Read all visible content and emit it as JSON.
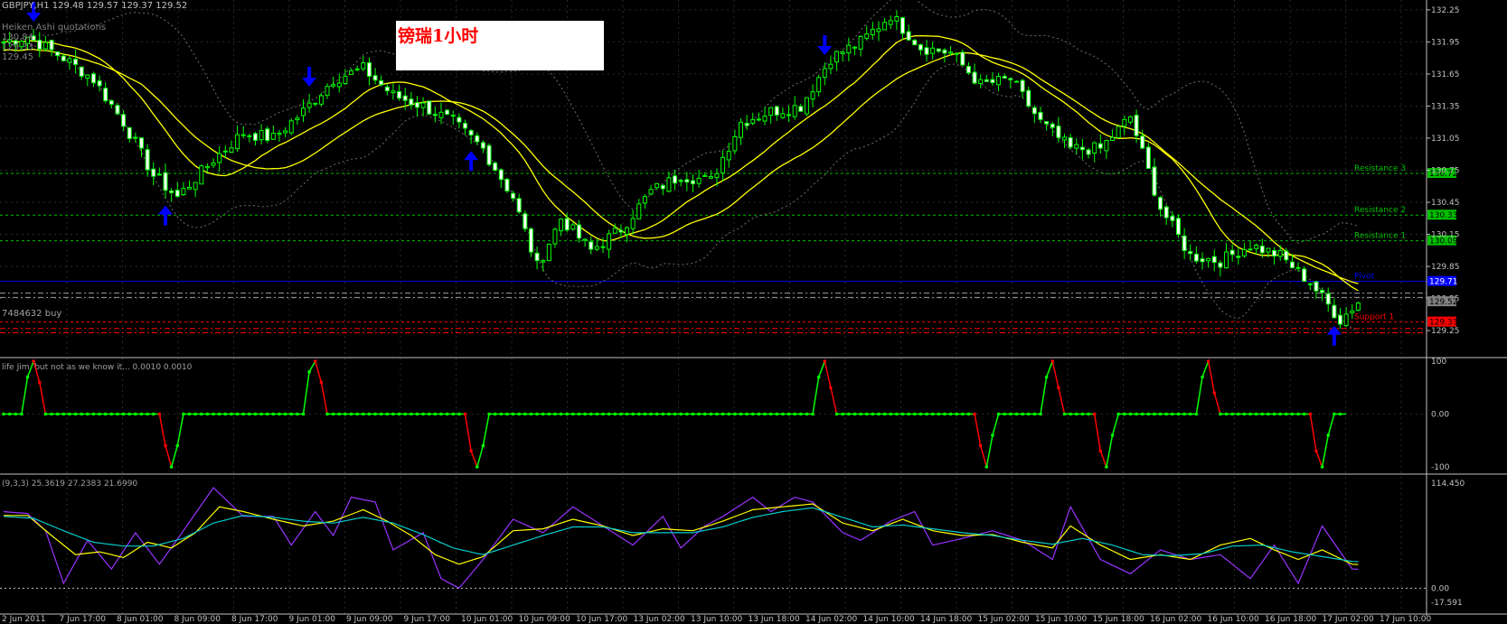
{
  "header": {
    "symbol_line": "GBPJPY,H1  129.48 129.57 129.37 129.52",
    "quotes_label": "Heiken Ashi quotations",
    "quote_lines": [
      "130.84",
      "129.33",
      "129.45"
    ],
    "order_label": "7484632 buy"
  },
  "title_box": {
    "text": "镑瑞1小时"
  },
  "colors": {
    "background": "#000000",
    "bull_candle": "#00ff00",
    "bear_candle": "#ffffff",
    "ma": "#ffff00",
    "resistance": "#00c000",
    "support": "#ff0000",
    "pivot": "#0000ff",
    "arrow": "#0000ff",
    "osc_up": "#00ff00",
    "osc_down": "#ff0000",
    "stoch_k": "#9933ff",
    "stoch_d": "#ffff00",
    "stoch_slow": "#00cccc"
  },
  "chart_data": [
    {
      "type": "candlestick",
      "title": "GBPJPY,H1",
      "ylim": [
        129.2,
        132.3
      ],
      "price_ticks": [
        "132.25",
        "131.95",
        "131.65",
        "131.35",
        "131.05",
        "130.75",
        "130.45",
        "130.15",
        "129.85",
        "129.55",
        "129.25"
      ],
      "levels": [
        {
          "name": "Resistance 3",
          "value": 130.72,
          "label": "130.72",
          "color": "#00c000"
        },
        {
          "name": "Resistance 2",
          "value": 130.33,
          "label": "130.33",
          "color": "#00c000"
        },
        {
          "name": "Resistance 1",
          "value": 130.09,
          "label": "130.09",
          "color": "#00c000"
        },
        {
          "name": "Pivot",
          "value": 129.71,
          "label": "129.71",
          "color": "#0000ff"
        },
        {
          "name": "Support 1",
          "value": 129.33,
          "label": "129.33",
          "color": "#ff0000"
        }
      ],
      "buy_line": 129.6,
      "current_price": {
        "value": 129.52,
        "label": "129.52"
      },
      "x_labels": [
        "2 Jun 2011",
        "7 Jun 17:00",
        "8 Jun 01:00",
        "8 Jun 09:00",
        "8 Jun 17:00",
        "9 Jun 01:00",
        "9 Jun 09:00",
        "9 Jun 17:00",
        "10 Jun 01:00",
        "10 Jun 09:00",
        "10 Jun 17:00",
        "13 Jun 02:00",
        "13 Jun 10:00",
        "13 Jun 18:00",
        "14 Jun 02:00",
        "14 Jun 10:00",
        "14 Jun 18:00",
        "15 Jun 02:00",
        "15 Jun 10:00",
        "15 Jun 18:00",
        "16 Jun 02:00",
        "16 Jun 10:00",
        "16 Jun 18:00",
        "17 Jun 02:00",
        "17 Jun 10:00"
      ],
      "anchors": [
        [
          0,
          131.95
        ],
        [
          4,
          132.0
        ],
        [
          10,
          131.8
        ],
        [
          15,
          131.6
        ],
        [
          20,
          131.2
        ],
        [
          25,
          130.7
        ],
        [
          29,
          130.5
        ],
        [
          35,
          130.85
        ],
        [
          40,
          131.1
        ],
        [
          45,
          131.05
        ],
        [
          50,
          131.3
        ],
        [
          55,
          131.6
        ],
        [
          60,
          131.7
        ],
        [
          65,
          131.45
        ],
        [
          70,
          131.35
        ],
        [
          75,
          131.2
        ],
        [
          80,
          130.95
        ],
        [
          85,
          130.5
        ],
        [
          89,
          129.85
        ],
        [
          93,
          130.3
        ],
        [
          98,
          130.0
        ],
        [
          103,
          130.2
        ],
        [
          108,
          130.55
        ],
        [
          113,
          130.7
        ],
        [
          118,
          130.65
        ],
        [
          123,
          131.2
        ],
        [
          128,
          131.3
        ],
        [
          133,
          131.35
        ],
        [
          138,
          131.8
        ],
        [
          143,
          131.95
        ],
        [
          148,
          132.2
        ],
        [
          153,
          131.9
        ],
        [
          158,
          131.85
        ],
        [
          163,
          131.55
        ],
        [
          168,
          131.6
        ],
        [
          173,
          131.2
        ],
        [
          178,
          130.95
        ],
        [
          183,
          130.95
        ],
        [
          188,
          131.25
        ],
        [
          193,
          130.4
        ],
        [
          198,
          129.95
        ],
        [
          203,
          129.9
        ],
        [
          208,
          130.05
        ],
        [
          213,
          129.95
        ],
        [
          218,
          129.7
        ],
        [
          223,
          129.35
        ],
        [
          226,
          129.52
        ]
      ],
      "arrows": [
        {
          "dir": "down",
          "bar": 5
        },
        {
          "dir": "up",
          "bar": 27
        },
        {
          "dir": "down",
          "bar": 51
        },
        {
          "dir": "up",
          "bar": 78
        },
        {
          "dir": "down",
          "bar": 137
        },
        {
          "dir": "up",
          "bar": 222
        }
      ]
    },
    {
      "type": "line",
      "title": "life Jim, but not as we know it... 0.0010 0.0010",
      "ylim": [
        -100,
        100
      ],
      "ticks": [
        "100",
        "0.00",
        "-100"
      ],
      "points": [
        [
          0,
          0
        ],
        [
          3,
          0
        ],
        [
          4,
          70
        ],
        [
          5,
          100
        ],
        [
          6,
          60
        ],
        [
          7,
          0
        ],
        [
          26,
          0
        ],
        [
          27,
          -60
        ],
        [
          28,
          -100
        ],
        [
          29,
          -60
        ],
        [
          30,
          0
        ],
        [
          50,
          0
        ],
        [
          51,
          80
        ],
        [
          52,
          100
        ],
        [
          53,
          60
        ],
        [
          54,
          0
        ],
        [
          77,
          0
        ],
        [
          78,
          -70
        ],
        [
          79,
          -100
        ],
        [
          80,
          -60
        ],
        [
          81,
          0
        ],
        [
          135,
          0
        ],
        [
          136,
          70
        ],
        [
          137,
          100
        ],
        [
          138,
          50
        ],
        [
          139,
          0
        ],
        [
          162,
          0
        ],
        [
          163,
          -60
        ],
        [
          164,
          -100
        ],
        [
          165,
          -40
        ],
        [
          166,
          0
        ],
        [
          173,
          0
        ],
        [
          174,
          70
        ],
        [
          175,
          100
        ],
        [
          176,
          50
        ],
        [
          177,
          0
        ],
        [
          182,
          0
        ],
        [
          183,
          -70
        ],
        [
          184,
          -100
        ],
        [
          185,
          -40
        ],
        [
          186,
          0
        ],
        [
          199,
          0
        ],
        [
          200,
          70
        ],
        [
          201,
          100
        ],
        [
          202,
          40
        ],
        [
          203,
          0
        ],
        [
          218,
          0
        ],
        [
          219,
          -70
        ],
        [
          220,
          -100
        ],
        [
          221,
          -40
        ],
        [
          222,
          0
        ],
        [
          224,
          0
        ]
      ]
    },
    {
      "type": "line",
      "title": "(9,3,3) 25.3619 27.2383 21.6990",
      "ylim": [
        -17.591,
        114.45
      ],
      "ticks": [
        "114.450",
        "0.00",
        "-17.591"
      ],
      "series": [
        {
          "name": "K",
          "anchors": [
            [
              0,
              80
            ],
            [
              4,
              78
            ],
            [
              7,
              60
            ],
            [
              10,
              5
            ],
            [
              14,
              50
            ],
            [
              18,
              20
            ],
            [
              22,
              58
            ],
            [
              26,
              25
            ],
            [
              30,
              60
            ],
            [
              35,
              105
            ],
            [
              40,
              75
            ],
            [
              45,
              75
            ],
            [
              48,
              45
            ],
            [
              52,
              80
            ],
            [
              55,
              55
            ],
            [
              58,
              95
            ],
            [
              62,
              90
            ],
            [
              65,
              40
            ],
            [
              70,
              58
            ],
            [
              73,
              10
            ],
            [
              76,
              0
            ],
            [
              80,
              30
            ],
            [
              85,
              72
            ],
            [
              90,
              58
            ],
            [
              95,
              85
            ],
            [
              100,
              65
            ],
            [
              105,
              45
            ],
            [
              110,
              75
            ],
            [
              113,
              42
            ],
            [
              117,
              65
            ],
            [
              120,
              75
            ],
            [
              125,
              95
            ],
            [
              128,
              80
            ],
            [
              132,
              95
            ],
            [
              135,
              90
            ],
            [
              140,
              58
            ],
            [
              143,
              50
            ],
            [
              148,
              70
            ],
            [
              152,
              80
            ],
            [
              155,
              45
            ],
            [
              160,
              52
            ],
            [
              165,
              60
            ],
            [
              170,
              50
            ],
            [
              175,
              30
            ],
            [
              178,
              85
            ],
            [
              183,
              30
            ],
            [
              188,
              15
            ],
            [
              193,
              40
            ],
            [
              198,
              30
            ],
            [
              203,
              35
            ],
            [
              208,
              10
            ],
            [
              212,
              45
            ],
            [
              216,
              5
            ],
            [
              220,
              65
            ],
            [
              225,
              20
            ]
          ]
        },
        {
          "name": "D",
          "anchors": [
            [
              0,
              76
            ],
            [
              4,
              76
            ],
            [
              8,
              55
            ],
            [
              12,
              35
            ],
            [
              16,
              38
            ],
            [
              20,
              32
            ],
            [
              24,
              48
            ],
            [
              28,
              42
            ],
            [
              32,
              58
            ],
            [
              36,
              85
            ],
            [
              40,
              80
            ],
            [
              45,
              72
            ],
            [
              50,
              65
            ],
            [
              55,
              70
            ],
            [
              60,
              82
            ],
            [
              64,
              70
            ],
            [
              68,
              55
            ],
            [
              72,
              35
            ],
            [
              76,
              25
            ],
            [
              80,
              33
            ],
            [
              85,
              60
            ],
            [
              90,
              62
            ],
            [
              95,
              72
            ],
            [
              100,
              65
            ],
            [
              105,
              55
            ],
            [
              110,
              62
            ],
            [
              115,
              60
            ],
            [
              120,
              70
            ],
            [
              125,
              82
            ],
            [
              130,
              85
            ],
            [
              135,
              88
            ],
            [
              140,
              68
            ],
            [
              145,
              60
            ],
            [
              150,
              72
            ],
            [
              155,
              60
            ],
            [
              160,
              55
            ],
            [
              165,
              56
            ],
            [
              170,
              48
            ],
            [
              175,
              42
            ],
            [
              178,
              65
            ],
            [
              183,
              45
            ],
            [
              188,
              30
            ],
            [
              193,
              35
            ],
            [
              198,
              30
            ],
            [
              203,
              45
            ],
            [
              208,
              52
            ],
            [
              212,
              40
            ],
            [
              216,
              30
            ],
            [
              220,
              40
            ],
            [
              225,
              25
            ]
          ]
        },
        {
          "name": "Signal",
          "anchors": [
            [
              0,
              75
            ],
            [
              5,
              73
            ],
            [
              10,
              60
            ],
            [
              15,
              48
            ],
            [
              20,
              44
            ],
            [
              25,
              44
            ],
            [
              30,
              52
            ],
            [
              35,
              68
            ],
            [
              40,
              76
            ],
            [
              45,
              74
            ],
            [
              50,
              70
            ],
            [
              55,
              68
            ],
            [
              60,
              74
            ],
            [
              65,
              68
            ],
            [
              70,
              56
            ],
            [
              75,
              42
            ],
            [
              80,
              35
            ],
            [
              85,
              45
            ],
            [
              90,
              55
            ],
            [
              95,
              64
            ],
            [
              100,
              64
            ],
            [
              105,
              58
            ],
            [
              110,
              58
            ],
            [
              115,
              58
            ],
            [
              120,
              64
            ],
            [
              125,
              74
            ],
            [
              130,
              80
            ],
            [
              135,
              84
            ],
            [
              140,
              74
            ],
            [
              145,
              64
            ],
            [
              150,
              66
            ],
            [
              155,
              62
            ],
            [
              160,
              58
            ],
            [
              165,
              55
            ],
            [
              170,
              50
            ],
            [
              175,
              46
            ],
            [
              180,
              52
            ],
            [
              185,
              45
            ],
            [
              190,
              35
            ],
            [
              195,
              34
            ],
            [
              200,
              36
            ],
            [
              205,
              44
            ],
            [
              210,
              45
            ],
            [
              215,
              38
            ],
            [
              220,
              33
            ],
            [
              225,
              28
            ]
          ]
        }
      ]
    }
  ]
}
